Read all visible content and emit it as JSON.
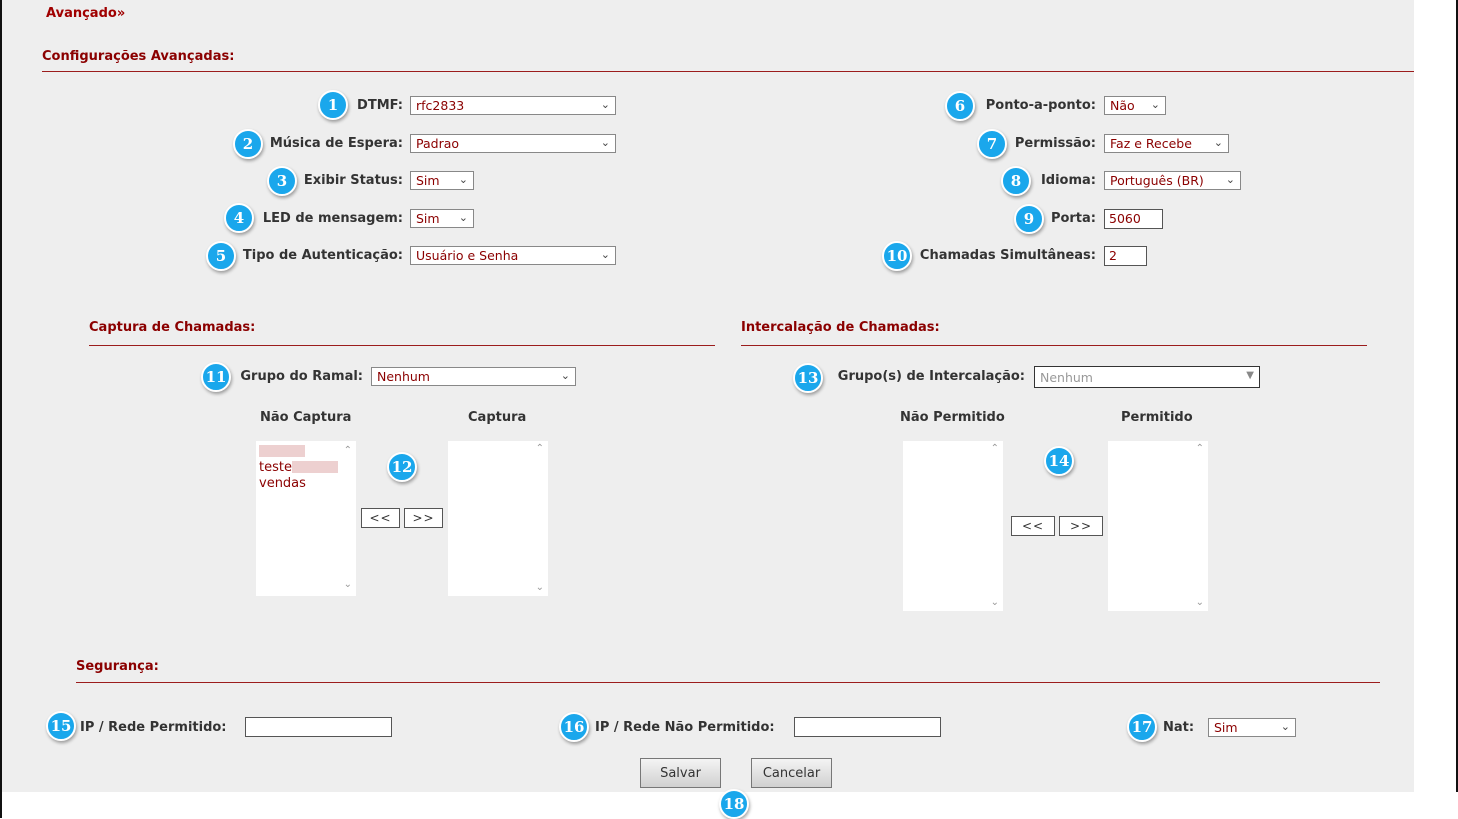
{
  "title": "Avançado»",
  "section_main": "Configurações Avançadas:",
  "left_fields": [
    {
      "badge": "1",
      "label": "DTMF:",
      "value": "rfc2833"
    },
    {
      "badge": "2",
      "label": "Música de Espera:",
      "value": "Padrao"
    },
    {
      "badge": "3",
      "label": "Exibir Status:",
      "value": "Sim"
    },
    {
      "badge": "4",
      "label": "LED de mensagem:",
      "value": "Sim"
    },
    {
      "badge": "5",
      "label": "Tipo de Autenticação:",
      "value": "Usuário e Senha"
    }
  ],
  "right_fields": [
    {
      "badge": "6",
      "label": "Ponto-a-ponto:",
      "value": "Não"
    },
    {
      "badge": "7",
      "label": "Permissão:",
      "value": "Faz e Recebe"
    },
    {
      "badge": "8",
      "label": "Idioma:",
      "value": "Português (BR)"
    },
    {
      "badge": "9",
      "label": "Porta:",
      "value": "5060"
    },
    {
      "badge": "10",
      "label": "Chamadas Simultâneas:",
      "value": "2"
    }
  ],
  "capture": {
    "title": "Captura de Chamadas:",
    "group_badge": "11",
    "group_label": "Grupo do Ramal:",
    "group_value": "Nenhum",
    "col_left": "Não Captura",
    "col_right": "Captura",
    "items": [
      "",
      "teste",
      "vendas"
    ],
    "lists_badge": "12",
    "btn_left": "<<",
    "btn_right": ">>"
  },
  "intercalation": {
    "title": "Intercalação de Chamadas:",
    "group_badge": "13",
    "group_label": "Grupo(s) de Intercalação:",
    "group_value": "Nenhum",
    "col_left": "Não Permitido",
    "col_right": "Permitido",
    "lists_badge": "14",
    "btn_left": "<<",
    "btn_right": ">>"
  },
  "security": {
    "title": "Segurança:",
    "ip_allowed_badge": "15",
    "ip_allowed_label": "IP / Rede Permitido:",
    "ip_allowed_value": "",
    "ip_denied_badge": "16",
    "ip_denied_label": "IP / Rede Não Permitido:",
    "ip_denied_value": "",
    "nat_badge": "17",
    "nat_label": "Nat:",
    "nat_value": "Sim"
  },
  "actions": {
    "save": "Salvar",
    "cancel": "Cancelar",
    "badge": "18"
  },
  "icons": {
    "select": "chevron-down-icon",
    "scroll_up": "scroll-up-icon",
    "scroll_down": "scroll-down-icon"
  },
  "colors": {
    "accent": "#8b0000",
    "badge": "#1aa7ec",
    "panel": "#eeeeee"
  }
}
